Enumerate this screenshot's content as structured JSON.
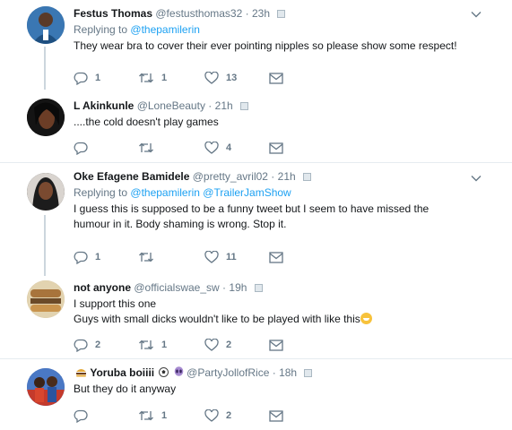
{
  "tweets": [
    {
      "name": "Festus Thomas",
      "handle": "@festusthomas32",
      "dot": "·",
      "time": "23h",
      "replying_prefix": "Replying to",
      "replying_to": [
        "@thepamilerin"
      ],
      "text": "They wear bra to cover their ever pointing nipples so please show some respect!",
      "replies": "1",
      "retweets": "1",
      "likes": "13"
    },
    {
      "name": "L Akinkunle",
      "handle": "@LoneBeauty",
      "dot": "·",
      "time": "21h",
      "text": "....the cold doesn't play games",
      "replies": "",
      "retweets": "",
      "likes": "4"
    },
    {
      "name": "Oke Efagene Bamidele",
      "handle": "@pretty_avril02",
      "dot": "·",
      "time": "21h",
      "replying_prefix": "Replying to",
      "replying_to": [
        "@thepamilerin",
        "@TrailerJamShow"
      ],
      "text_line1": "I guess this is supposed to be a funny tweet but I seem to have missed the",
      "text_line2": "humour in it. Body shaming is wrong. Stop it.",
      "replies": "1",
      "retweets": "",
      "likes": "11"
    },
    {
      "name": "not anyone",
      "handle": "@officialswae_sw",
      "dot": "·",
      "time": "19h",
      "text_line1": "I support this one",
      "text_line2": "Guys with small dicks wouldn't like to be played with like this",
      "replies": "2",
      "retweets": "1",
      "likes": "2"
    },
    {
      "name_prefix_emoji": "burger-icon",
      "name": "Yoruba boiiii",
      "handle": "@PartyJollofRice",
      "dot": "·",
      "time": "18h",
      "text": "But they do it anyway",
      "replies": "",
      "retweets": "1",
      "likes": "2"
    }
  ],
  "colors": {
    "link": "#1da1f2",
    "muted": "#657786",
    "text": "#14171a",
    "divider": "#e6ecf0",
    "thread_line": "#ccd6dd"
  }
}
